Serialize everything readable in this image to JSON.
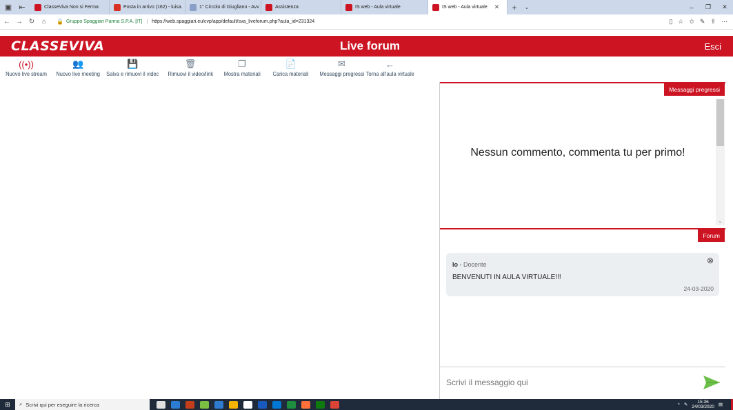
{
  "browser": {
    "tabs": [
      {
        "label": "ClasseViva Non si Ferma",
        "color": "#cc1423"
      },
      {
        "label": "Posta in arrivo (162) - luisa.",
        "color": "#d93025"
      },
      {
        "label": "1° Circolo di Giugliano - Avv",
        "color": "#8aa0c8"
      },
      {
        "label": "Assistenza",
        "color": "#cc1423"
      },
      {
        "label": "IS web - Aula virtuale",
        "color": "#cc1423"
      },
      {
        "label": "IS web - Aula virtuale",
        "color": "#cc1423",
        "active": true
      }
    ],
    "url_org": "Gruppo Spaggiari Parma S.P.A. [IT]",
    "url": "https://web.spaggiari.eu/cvp/app/default/sva_liveforum.php?aula_id=231324"
  },
  "app": {
    "logo": "CLASSEVIVA",
    "title": "Live forum",
    "logout": "Esci",
    "brand_color": "#cc1423"
  },
  "toolbar": [
    {
      "label": "Nuovo live stream",
      "icon": "broadcast-icon",
      "glyph": "((•))",
      "red": true
    },
    {
      "label": "Nuovo live meeting",
      "icon": "users-icon",
      "glyph": "👥"
    },
    {
      "label": "Salva e rimuovi il videc",
      "icon": "save-icon",
      "glyph": "💾"
    },
    {
      "label": "Rimuovi il video/link",
      "icon": "trash-icon",
      "glyph": "🗑"
    },
    {
      "label": "Mostra materiali",
      "icon": "copy-icon",
      "glyph": "❐"
    },
    {
      "label": "Carica materiali",
      "icon": "upload-doc-icon",
      "glyph": "📄"
    },
    {
      "label": "Messaggi pregressi",
      "icon": "mail-history-icon",
      "glyph": "✉"
    },
    {
      "label": "Torna all'aula virtuale",
      "icon": "arrow-left-icon",
      "glyph": "←"
    }
  ],
  "panel": {
    "history_tag": "Messaggi pregressi",
    "empty_message": "Nessun commento, commenta tu per primo!",
    "forum_tag": "Forum",
    "message": {
      "author": "Io",
      "role": "Docente",
      "text": "BENVENUTI IN AULA VIRTUALE!!!",
      "date": "24-03-2020"
    },
    "composer_placeholder": "Scrivi il messaggio qui"
  },
  "taskbar": {
    "search_placeholder": "Scrivi qui per eseguire la ricerca",
    "time": "15:36",
    "date": "24/03/2020",
    "app_colors": [
      "#e0e0e0",
      "#2b7cd3",
      "#c43e1c",
      "#7bc043",
      "#2e7bcf",
      "#f4b400",
      "#ffffff",
      "#185abd",
      "#0078d4",
      "#1e8e3e",
      "#ff7139",
      "#0f7b0f",
      "#db4437"
    ]
  }
}
